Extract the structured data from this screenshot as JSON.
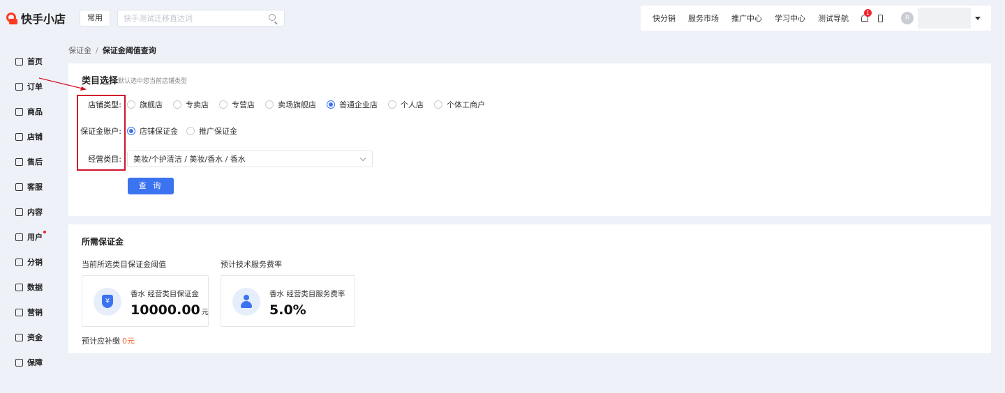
{
  "app": {
    "logo_text": "快手小店"
  },
  "header": {
    "fav_button": "常用",
    "search_placeholder": "快手测试迁移直达词",
    "nav": [
      "快分销",
      "服务市场",
      "推广中心",
      "学习中心",
      "测试导航"
    ],
    "notification_count": "1",
    "avatar_initial": "R"
  },
  "sidebar": {
    "items": [
      {
        "label": "首页",
        "icon": "home-icon"
      },
      {
        "label": "订单",
        "icon": "order-icon"
      },
      {
        "label": "商品",
        "icon": "product-icon"
      },
      {
        "label": "店铺",
        "icon": "shop-icon"
      },
      {
        "label": "售后",
        "icon": "after-sale-icon"
      },
      {
        "label": "客服",
        "icon": "customer-service-icon"
      },
      {
        "label": "内容",
        "icon": "content-icon"
      },
      {
        "label": "用户",
        "icon": "user-icon"
      },
      {
        "label": "分销",
        "icon": "distribution-icon"
      },
      {
        "label": "数据",
        "icon": "data-icon"
      },
      {
        "label": "营销",
        "icon": "marketing-icon"
      },
      {
        "label": "资金",
        "icon": "funds-icon"
      },
      {
        "label": "保障",
        "icon": "guarantee-icon"
      }
    ]
  },
  "breadcrumb": {
    "parent": "保证金",
    "separator": "/",
    "current": "保证金阈值查询"
  },
  "category_form": {
    "title": "类目选择",
    "hint": "默认选中您当前店铺类型",
    "shop_type_label": "店铺类型:",
    "shop_types": [
      "旗舰店",
      "专卖店",
      "专营店",
      "卖场旗舰店",
      "普通企业店",
      "个人店",
      "个体工商户"
    ],
    "shop_type_selected": "普通企业店",
    "account_label": "保证金账户:",
    "accounts": [
      "店铺保证金",
      "推广保证金"
    ],
    "account_selected": "店铺保证金",
    "category_label": "经营类目:",
    "category_value": "美妆/个护清洁 / 美妆/香水 / 香水",
    "query_button": "查 询"
  },
  "deposit": {
    "title": "所需保证金",
    "threshold_label": "当前所选类目保证金阈值",
    "fee_label": "预计技术服务费率",
    "deposit_card": {
      "label": "香水 经营类目保证金",
      "value": "10000.00",
      "unit": "元"
    },
    "fee_card": {
      "label": "香水 经营类目服务费率",
      "value": "5.0%"
    },
    "supplement_label": "预计应补缴",
    "supplement_value": "0元"
  },
  "colors": {
    "primary": "#3b73f1",
    "brand": "#fe3b1f",
    "annotation": "#d0142c",
    "amount": "#f06a3a"
  }
}
